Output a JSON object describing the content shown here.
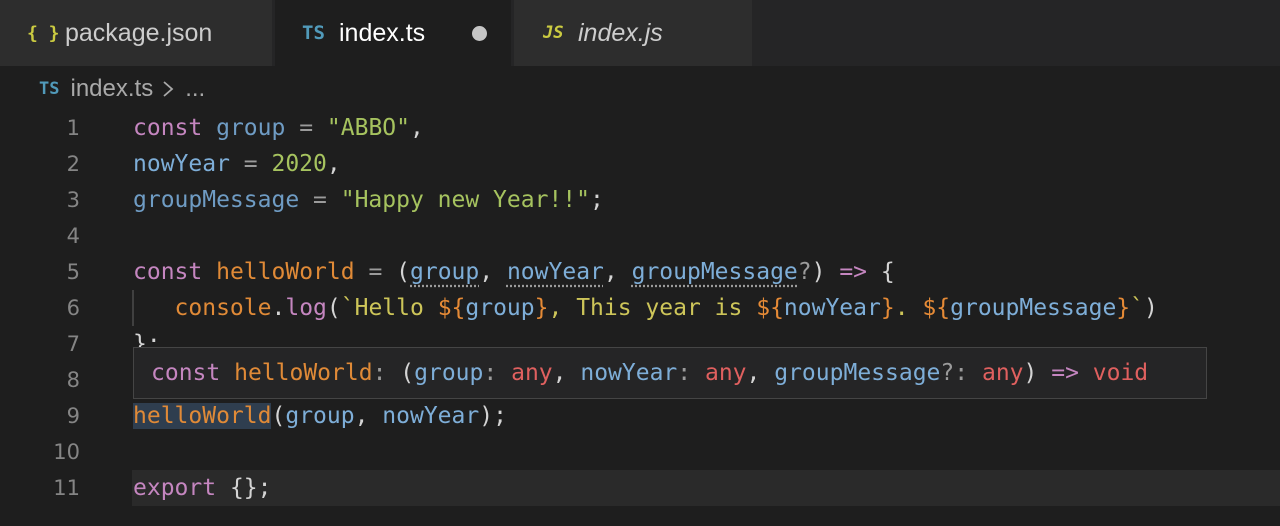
{
  "tabs": [
    {
      "icon": "{ }",
      "label": "package.json",
      "active": false
    },
    {
      "icon": "TS",
      "label": "index.ts",
      "active": true,
      "dirty": true
    },
    {
      "icon": "JS",
      "label": "index.js",
      "active": false
    }
  ],
  "breadcrumb": {
    "icon": "TS",
    "file": "index.ts",
    "rest": "..."
  },
  "editor": {
    "line_numbers": [
      "1",
      "2",
      "3",
      "4",
      "5",
      "6",
      "7",
      "8",
      "9",
      "10",
      "11"
    ],
    "lines": {
      "l1": {
        "const": "const",
        "group": "group",
        "eq": " = ",
        "value": "\"ABBO\"",
        "comma": ","
      },
      "l2": {
        "name": "nowYear",
        "eq": " = ",
        "value": "2020",
        "comma": ","
      },
      "l3": {
        "name": "groupMessage",
        "eq": " = ",
        "value": "\"Happy new Year!!\"",
        "semi": ";"
      },
      "l5": {
        "const": "const",
        "fn": "helloWorld",
        "eq": " = ",
        "open": "(",
        "p1": "group",
        "c1": ", ",
        "p2": "nowYear",
        "c2": ", ",
        "p3": "groupMessage",
        "q": "?",
        "close": ")",
        "arrow": " => ",
        "brace": "{"
      },
      "l6": {
        "indent": "   ",
        "console": "console",
        "dot": ".",
        "log": "log",
        "open": "(",
        "tick1": "`Hello ",
        "s1": "${",
        "v1": "group",
        "e1": "}",
        "t2": ", This year is ",
        "s2": "${",
        "v2": "nowYear",
        "e2": "}",
        "t3": ". ",
        "s3": "${",
        "v3": "groupMessage",
        "e3": "}",
        "tick2": "`",
        "close": ")"
      },
      "l7": {
        "text": "};"
      },
      "l9": {
        "fn": "helloWorld",
        "open": "(",
        "a1": "group",
        "c": ", ",
        "a2": "nowYear",
        "close": ");"
      },
      "l11": {
        "kw": "export",
        "rest": " {};"
      }
    }
  },
  "tooltip": {
    "const": "const",
    "name": " helloWorld",
    "colon": ": ",
    "open": "(",
    "p1": "group",
    "c1": ": ",
    "t1": "any",
    "sep1": ", ",
    "p2": "nowYear",
    "c2": ": ",
    "t2": "any",
    "sep2": ", ",
    "p3": "groupMessage",
    "q": "?",
    "c3": ": ",
    "t3": "any",
    "close": ")",
    "arrow": " => ",
    "ret": "void"
  }
}
